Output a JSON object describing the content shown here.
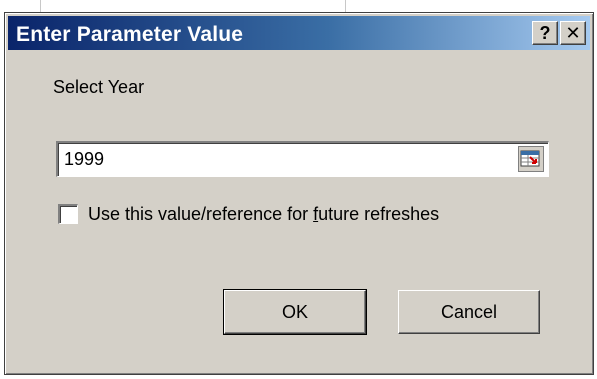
{
  "dialog": {
    "title": "Enter Parameter Value",
    "help_label": "?",
    "close_label": "✕"
  },
  "prompt": {
    "label": "Select Year",
    "value": "1999"
  },
  "checkbox": {
    "checked": false,
    "label_prefix": "Use this value/reference for ",
    "label_accel": "f",
    "label_suffix": "uture refreshes"
  },
  "buttons": {
    "ok_label": "OK",
    "cancel_label": "Cancel"
  },
  "icons": {
    "help": "help-icon",
    "close": "close-icon",
    "range_ref": "range-reference-icon"
  },
  "colors": {
    "title_start": "#0a246a",
    "title_end": "#a6caf0",
    "dialog_face": "#d4d0c8"
  }
}
